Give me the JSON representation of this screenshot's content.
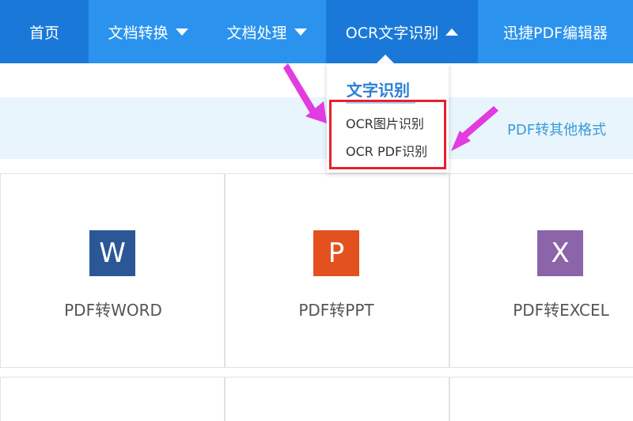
{
  "nav": {
    "items": [
      {
        "label": "首页"
      },
      {
        "label": "文档转换"
      },
      {
        "label": "文档处理"
      },
      {
        "label": "OCR文字识别"
      },
      {
        "label": "迅捷PDF编辑器"
      }
    ]
  },
  "dropdown": {
    "title": "文字识别",
    "items": [
      {
        "label": "OCR图片识别"
      },
      {
        "label": "OCR PDF识别"
      }
    ]
  },
  "subbar": {
    "link": "PDF转其他格式"
  },
  "cards": [
    {
      "letter": "W",
      "label": "PDF转WORD",
      "color": "#2b5797"
    },
    {
      "letter": "P",
      "label": "PDF转PPT",
      "color": "#e2511e"
    },
    {
      "letter": "X",
      "label": "PDF转EXCEL",
      "color": "#8b64a9"
    }
  ],
  "colors": {
    "nav_bg": "#2b93ee",
    "nav_active": "#1a79d8",
    "highlight_box": "#e8202e",
    "arrow": "#e23be0"
  }
}
